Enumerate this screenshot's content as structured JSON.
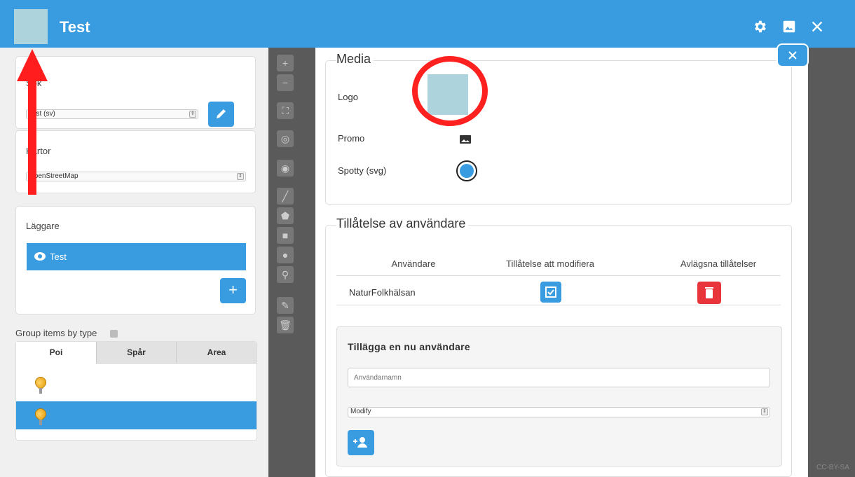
{
  "header": {
    "title": "Test",
    "icons": [
      "gear-icon",
      "image-icon",
      "close-icon"
    ],
    "color": "#3a9ce0"
  },
  "sidebar": {
    "sok_panel": {
      "title": "Sök",
      "select_value": "Test (sv)"
    },
    "kartor_panel": {
      "title": "Kartor",
      "select_value": "OpenStreetMap"
    },
    "laggare_panel": {
      "title": "Läggare",
      "active_item": "Test"
    },
    "group_label": "Group items by type",
    "tabs": [
      {
        "label": "Poi",
        "active": true
      },
      {
        "label": "Spår",
        "active": false
      },
      {
        "label": "Area",
        "active": false
      }
    ]
  },
  "media": {
    "legend": "Media",
    "rows": [
      {
        "label": "Logo"
      },
      {
        "label": "Promo"
      },
      {
        "label": "Spotty (svg)"
      }
    ]
  },
  "permissions": {
    "legend": "Tillåtelse av användare",
    "headers": [
      "Användare",
      "Tillåtelse att modifiera",
      "Avlägsna tillåtelser"
    ],
    "rows": [
      {
        "user": "NaturFolkhälsan",
        "can_modify": true
      }
    ],
    "add_user": {
      "title": "Tillägga en nu användare",
      "username_placeholder": "Användarnamn",
      "permission_value": "Modify"
    }
  },
  "map_attribution": "CC-BY-SA"
}
